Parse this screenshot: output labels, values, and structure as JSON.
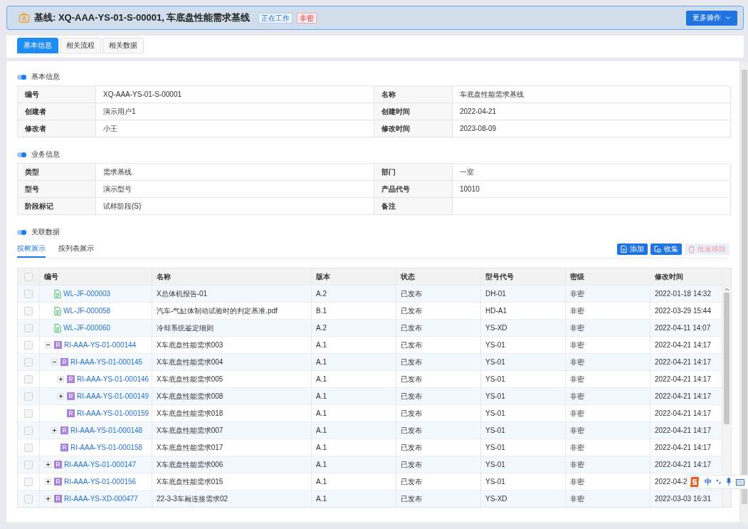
{
  "header": {
    "title": "基线: XQ-AAA-YS-01-S-00001, 车底盘性能需求基线",
    "badges": [
      {
        "label": "正在工作",
        "kind": "status"
      },
      {
        "label": "非密",
        "kind": "secret"
      }
    ],
    "more_button": "更多操作"
  },
  "tabs": [
    {
      "label": "基本信息",
      "selected": true
    },
    {
      "label": "相关流程",
      "selected": false
    },
    {
      "label": "相关数据",
      "selected": false
    }
  ],
  "sections": [
    {
      "title": "基本信息",
      "rows": [
        [
          {
            "label": "编号",
            "value": "XQ-AAA-YS-01-S-00001"
          },
          {
            "label": "名称",
            "value": "车底盘性能需求基线"
          }
        ],
        [
          {
            "label": "创建者",
            "value": "演示用户1"
          },
          {
            "label": "创建时间",
            "value": "2022-04-21"
          }
        ],
        [
          {
            "label": "修改者",
            "value": "小王"
          },
          {
            "label": "修改时间",
            "value": "2023-08-09"
          }
        ]
      ]
    },
    {
      "title": "业务信息",
      "rows": [
        [
          {
            "label": "类型",
            "value": "需求基线"
          },
          {
            "label": "部门",
            "value": "一室"
          }
        ],
        [
          {
            "label": "型号",
            "value": "演示型号"
          },
          {
            "label": "产品代号",
            "value": "10010"
          }
        ],
        [
          {
            "label": "阶段标记",
            "value": "试样阶段(S)"
          },
          {
            "label": "备注"
          }
        ]
      ]
    }
  ],
  "related": {
    "title": "关联数据",
    "view_tabs": [
      {
        "label": "按树展示",
        "selected": true
      },
      {
        "label": "按列表展示",
        "selected": false
      }
    ],
    "actions": [
      {
        "label": "添加",
        "kind": "add",
        "disabled": false
      },
      {
        "label": "收集",
        "kind": "collect",
        "disabled": false
      },
      {
        "label": "批量移除",
        "kind": "remove",
        "disabled": true
      }
    ],
    "table": {
      "header_checked": false,
      "columns": [
        "编号",
        "名称",
        "版本",
        "状态",
        "型号代号",
        "密级",
        "修改时间"
      ],
      "rows": [
        {
          "kind": "doc",
          "expandable": false,
          "checked": false,
          "cells": [
            "WL-JF-000003",
            "X总体机报告-01",
            "A.2",
            "已发布",
            "DH-01",
            "非密",
            "2022-01-18 14:32"
          ]
        },
        {
          "kind": "doc",
          "expandable": false,
          "checked": false,
          "cells": [
            "WL-JF-000058",
            "汽车-气缸体制动试验时的判定基准.pdf",
            "B.1",
            "已发布",
            "HD-A1",
            "非密",
            "2022-03-29 15:44"
          ]
        },
        {
          "kind": "doc",
          "expandable": false,
          "checked": false,
          "cells": [
            "WL-JF-000060",
            "冷却系统鉴定细则",
            "A.2",
            "已发布",
            "YS-XD",
            "非密",
            "2022-04-11 14:07"
          ]
        },
        {
          "kind": "req",
          "expandable": true,
          "expanded": true,
          "checked": false,
          "cells": [
            "RI-AAA-YS-01-000144",
            "X车底盘性能需求003",
            "A.1",
            "已发布",
            "YS-01",
            "非密",
            "2022-04-21 14:17"
          ],
          "children": [
            {
              "kind": "req",
              "expandable": true,
              "expanded": true,
              "checked": false,
              "cells": [
                "RI-AAA-YS-01-000145",
                "X车底盘性能需求004",
                "A.1",
                "已发布",
                "YS-01",
                "非密",
                "2022-04-21 14:17"
              ],
              "children": [
                {
                  "kind": "req",
                  "expandable": true,
                  "expanded": false,
                  "checked": false,
                  "cells": [
                    "RI-AAA-YS-01-000146",
                    "X车底盘性能需求005",
                    "A.1",
                    "已发布",
                    "YS-01",
                    "非密",
                    "2022-04-21 14:17"
                  ]
                },
                {
                  "kind": "req",
                  "expandable": true,
                  "expanded": false,
                  "checked": false,
                  "cells": [
                    "RI-AAA-YS-01-000149",
                    "X车底盘性能需求008",
                    "A.1",
                    "已发布",
                    "YS-01",
                    "非密",
                    "2022-04-21 14:17"
                  ]
                },
                {
                  "kind": "req",
                  "expandable": false,
                  "checked": false,
                  "cells": [
                    "RI-AAA-YS-01-000159",
                    "X车底盘性能需求018",
                    "A.1",
                    "已发布",
                    "YS-01",
                    "非密",
                    "2022-04-21 14:17"
                  ]
                }
              ]
            },
            {
              "kind": "req",
              "expandable": true,
              "expanded": false,
              "checked": false,
              "cells": [
                "RI-AAA-YS-01-000148",
                "X车底盘性能需求007",
                "A.1",
                "已发布",
                "YS-01",
                "非密",
                "2022-04-21 14:17"
              ]
            },
            {
              "kind": "req",
              "expandable": false,
              "checked": false,
              "cells": [
                "RI-AAA-YS-01-000158",
                "X车底盘性能需求017",
                "A.1",
                "已发布",
                "YS-01",
                "非密",
                "2022-04-21 14:17"
              ]
            }
          ]
        },
        {
          "kind": "req",
          "expandable": true,
          "expanded": false,
          "checked": false,
          "cells": [
            "RI-AAA-YS-01-000147",
            "X车底盘性能需求006",
            "A.1",
            "已发布",
            "YS-01",
            "非密",
            "2022-04-21 14:17"
          ]
        },
        {
          "kind": "req",
          "expandable": true,
          "expanded": false,
          "checked": false,
          "cells": [
            "RI-AAA-YS-01-000156",
            "X车底盘性能需求015",
            "A.1",
            "已发布",
            "YS-01",
            "非密",
            "2022-04-2"
          ]
        },
        {
          "kind": "req",
          "expandable": true,
          "expanded": false,
          "checked": false,
          "cells": [
            "RI-AAA-YS-XD-000477",
            "22-3-3车厢连接需求02",
            "A.1",
            "已发布",
            "YS-XD",
            "非密",
            "2022-03-03 16:31"
          ]
        }
      ]
    }
  },
  "ime_toolbar": {
    "label": "中"
  }
}
